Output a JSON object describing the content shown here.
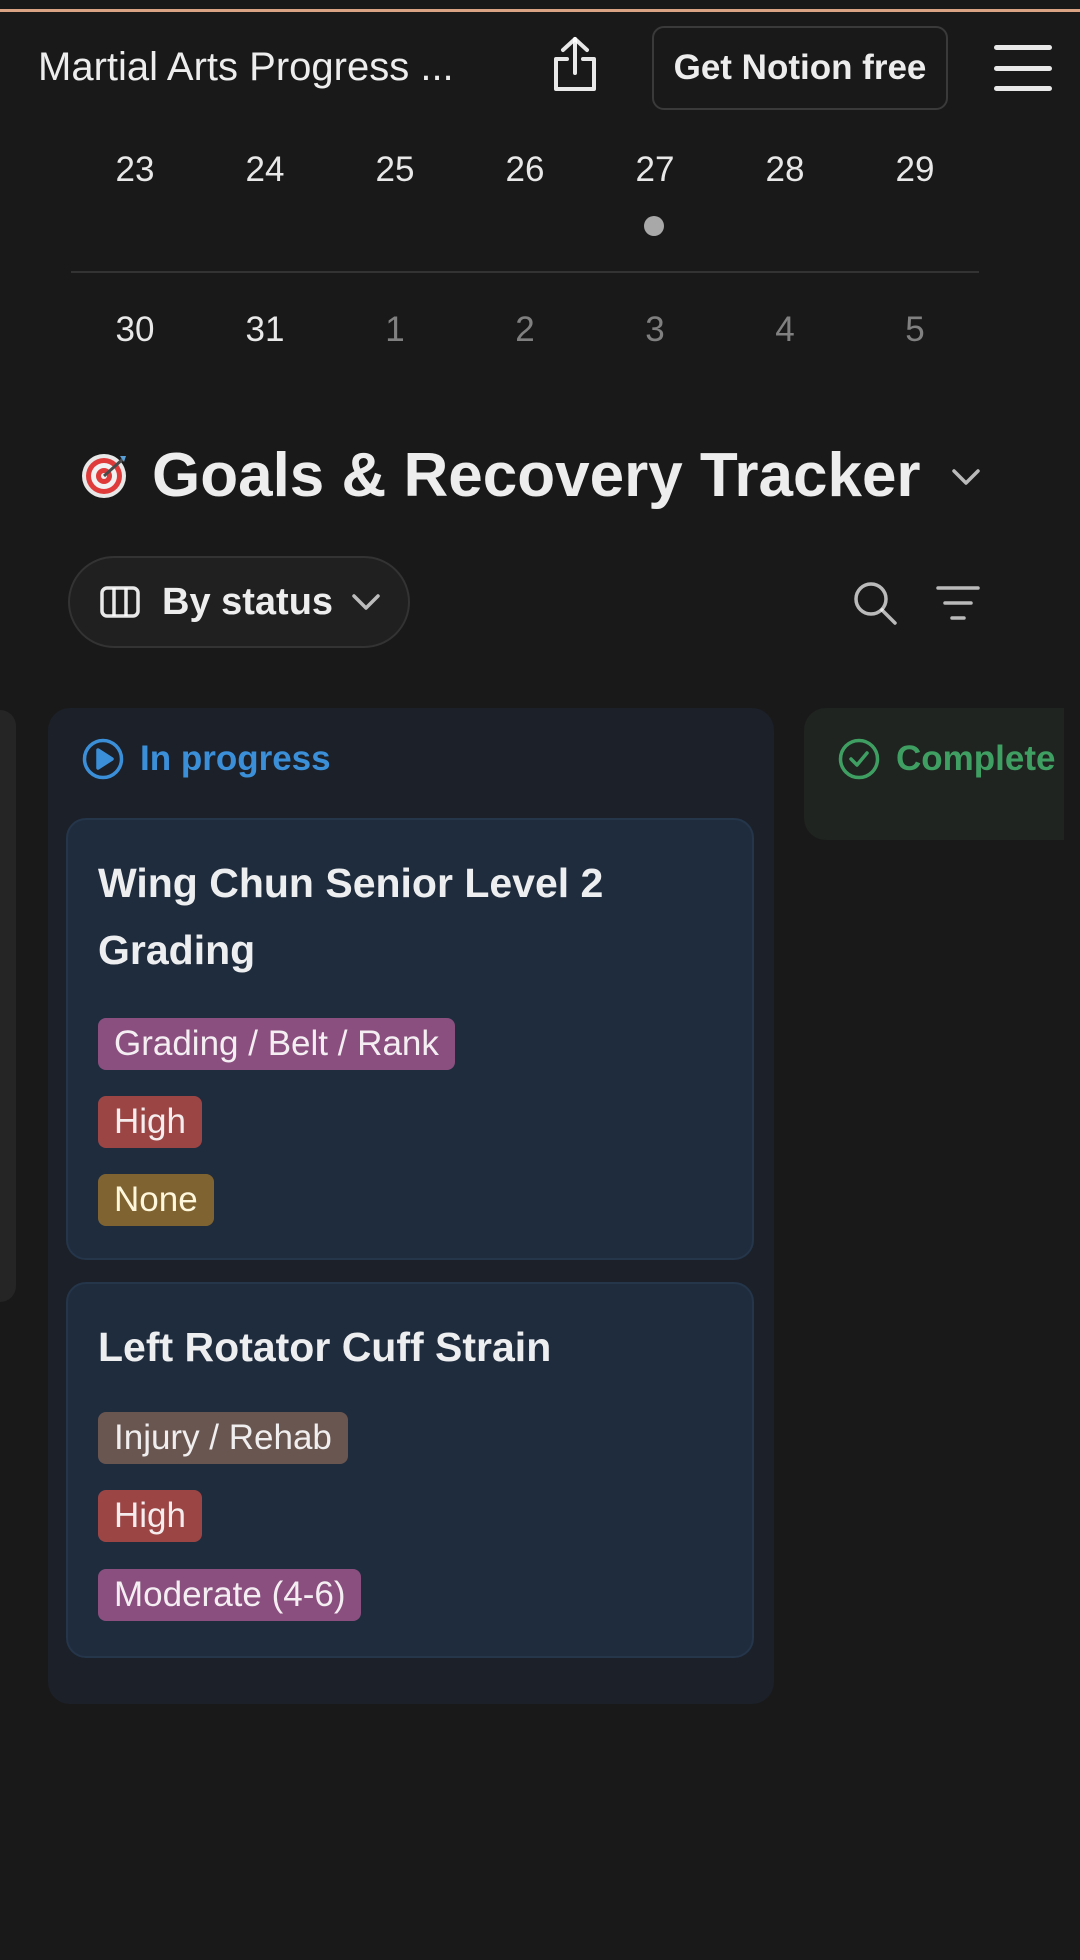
{
  "header": {
    "page_title": "Martial Arts Progress ...",
    "cta_label": "Get Notion free"
  },
  "calendar": {
    "week1": [
      "23",
      "24",
      "25",
      "26",
      "27",
      "28",
      "29"
    ],
    "week2_current": [
      "30",
      "31"
    ],
    "week2_next": [
      "1",
      "2",
      "3",
      "4",
      "5"
    ]
  },
  "database": {
    "title": "Goals & Recovery Tracker",
    "view_label": "By status"
  },
  "board": {
    "columns": [
      {
        "name": "In progress",
        "color": "#3b8fd9",
        "cards": [
          {
            "title": "Wing Chun Senior Level 2 Grading",
            "tags": [
              "Grading / Belt / Rank",
              "High",
              "None"
            ]
          },
          {
            "title": "Left Rotator Cuff Strain",
            "tags": [
              "Injury / Rehab",
              "High",
              "Moderate (4-6)"
            ]
          }
        ]
      },
      {
        "name": "Complete",
        "color": "#3f9f62",
        "cards": []
      }
    ]
  },
  "colors": {
    "background": "#191919",
    "accent_top": "#d9a384",
    "tag_purple": "#8a4f7f",
    "tag_red": "#9c4545",
    "tag_yellow": "#7f6432",
    "tag_brown": "#6a5650"
  },
  "icons": [
    "share-icon",
    "menu-icon",
    "target-icon",
    "chevron-down-icon",
    "board-view-icon",
    "search-icon",
    "filter-icon",
    "play-circle-icon",
    "check-circle-icon"
  ]
}
